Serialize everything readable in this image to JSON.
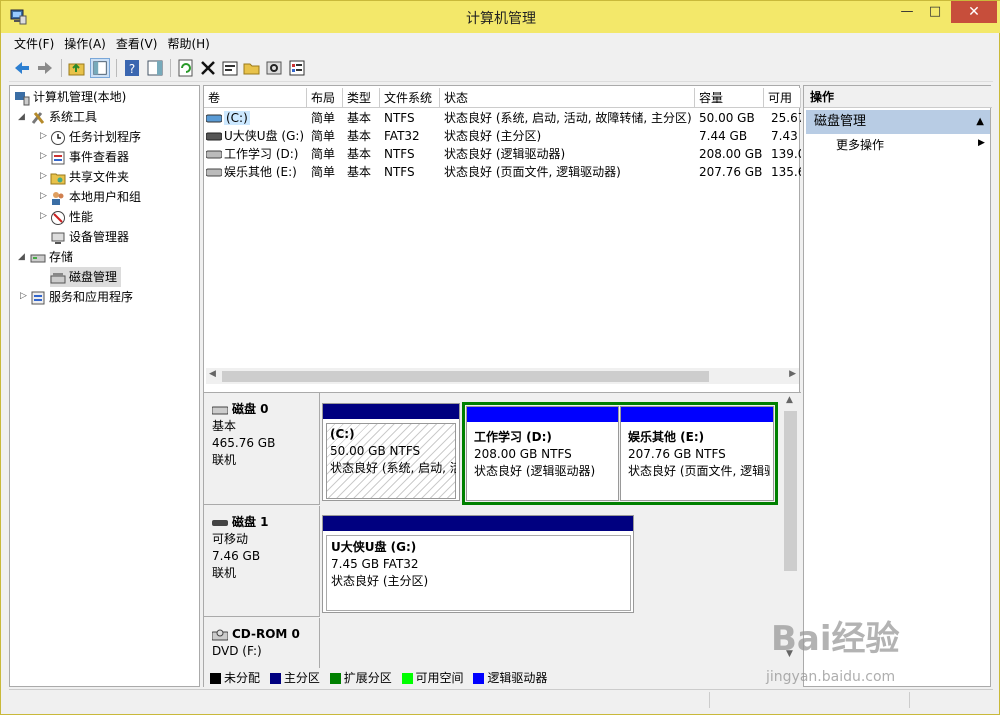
{
  "window": {
    "title": "计算机管理",
    "min": "—",
    "max": "□",
    "close": "✕"
  },
  "menu": [
    "文件(F)",
    "操作(A)",
    "查看(V)",
    "帮助(H)"
  ],
  "tree": {
    "root": "计算机管理(本地)",
    "system_tools": "系统工具",
    "task_scheduler": "任务计划程序",
    "event_viewer": "事件查看器",
    "shared_folders": "共享文件夹",
    "local_users": "本地用户和组",
    "performance": "性能",
    "device_manager": "设备管理器",
    "storage": "存储",
    "disk_management": "磁盘管理",
    "services_apps": "服务和应用程序"
  },
  "volume_columns": [
    "卷",
    "布局",
    "类型",
    "文件系统",
    "状态",
    "容量",
    "可用"
  ],
  "volumes": [
    {
      "name": "(C:)",
      "layout": "简单",
      "type": "基本",
      "fs": "NTFS",
      "status": "状态良好 (系统, 启动, 活动, 故障转储, 主分区)",
      "capacity": "50.00 GB",
      "free": "25.67"
    },
    {
      "name": "U大侠U盘 (G:)",
      "layout": "简单",
      "type": "基本",
      "fs": "FAT32",
      "status": "状态良好 (主分区)",
      "capacity": "7.44 GB",
      "free": "7.43"
    },
    {
      "name": "工作学习 (D:)",
      "layout": "简单",
      "type": "基本",
      "fs": "NTFS",
      "status": "状态良好 (逻辑驱动器)",
      "capacity": "208.00 GB",
      "free": "139.0"
    },
    {
      "name": "娱乐其他 (E:)",
      "layout": "简单",
      "type": "基本",
      "fs": "NTFS",
      "status": "状态良好 (页面文件, 逻辑驱动器)",
      "capacity": "207.76 GB",
      "free": "135.6"
    }
  ],
  "disks": [
    {
      "name": "磁盘 0",
      "kind": "基本",
      "size": "465.76 GB",
      "state": "联机"
    },
    {
      "name": "磁盘 1",
      "kind": "可移动",
      "size": "7.46 GB",
      "state": "联机"
    },
    {
      "name": "CD-ROM 0",
      "kind": "DVD (F:)",
      "size": "",
      "state": ""
    }
  ],
  "partitions": {
    "c": {
      "title": "(C:)",
      "size": "50.00 GB NTFS",
      "status": "状态良好 (系统, 启动, 活"
    },
    "d": {
      "title": "工作学习  (D:)",
      "size": "208.00 GB NTFS",
      "status": "状态良好 (逻辑驱动器)"
    },
    "e": {
      "title": "娱乐其他  (E:)",
      "size": "207.76 GB NTFS",
      "status": "状态良好 (页面文件, 逻辑驱"
    },
    "g": {
      "title": "U大侠U盘  (G:)",
      "size": "7.45 GB FAT32",
      "status": "状态良好 (主分区)"
    }
  },
  "legend": [
    {
      "label": "未分配",
      "color": "#000000"
    },
    {
      "label": "主分区",
      "color": "#000080"
    },
    {
      "label": "扩展分区",
      "color": "#008000"
    },
    {
      "label": "可用空间",
      "color": "#00ff00"
    },
    {
      "label": "逻辑驱动器",
      "color": "#0000ff"
    }
  ],
  "actions": {
    "header": "操作",
    "section": "磁盘管理",
    "more": "更多操作"
  },
  "watermark": {
    "brand": "Bai经验",
    "url": "jingyan.baidu.com"
  },
  "colors": {
    "titlebar": "#f3e86a",
    "primary": "#000080",
    "logical": "#0000ff",
    "extended": "#008000",
    "selection": "#cce8ff"
  }
}
